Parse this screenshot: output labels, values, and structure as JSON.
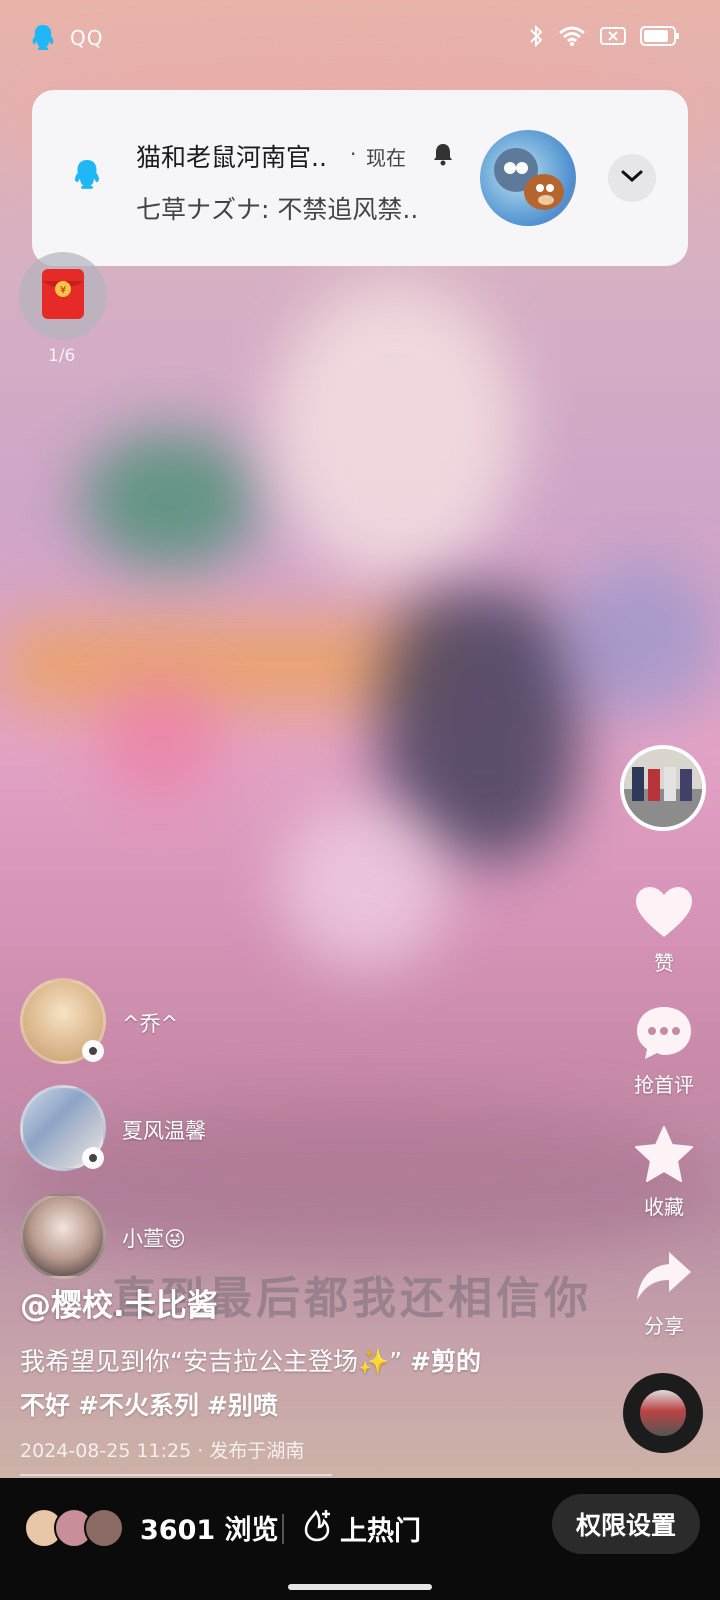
{
  "status_bar": {
    "app_name": "QQ"
  },
  "notification": {
    "title": "猫和老鼠河南官..",
    "dot": "·",
    "time": "现在",
    "message": "七草ナズナ: 不禁追风禁.."
  },
  "red_packet": {
    "count": "1/6"
  },
  "rail": {
    "like_label": "赞",
    "comment_label": "抢首评",
    "collect_label": "收藏",
    "share_label": "分享"
  },
  "viewers": [
    {
      "name": "^乔^"
    },
    {
      "name": "夏风温馨"
    },
    {
      "name": "小萱😜"
    }
  ],
  "video": {
    "watermark": "直到最后都我还相信你",
    "author": "@樱校.卡比酱",
    "caption_text": "我希望见到你“安吉拉公主登场✨”",
    "tags": [
      "#剪的不好",
      "#不火系列",
      "#别喷"
    ],
    "tag1_part1": "#剪的",
    "tag1_part2": "不好",
    "timestamp": "2024-08-25 11:25 · 发布于湖南"
  },
  "bottom_bar": {
    "views": "3601 浏览",
    "hot_label": "上热门",
    "permission_label": "权限设置"
  },
  "colors": {
    "accent_qq": "#1fb7f5",
    "bottom_bg": "#0b0b0b"
  }
}
